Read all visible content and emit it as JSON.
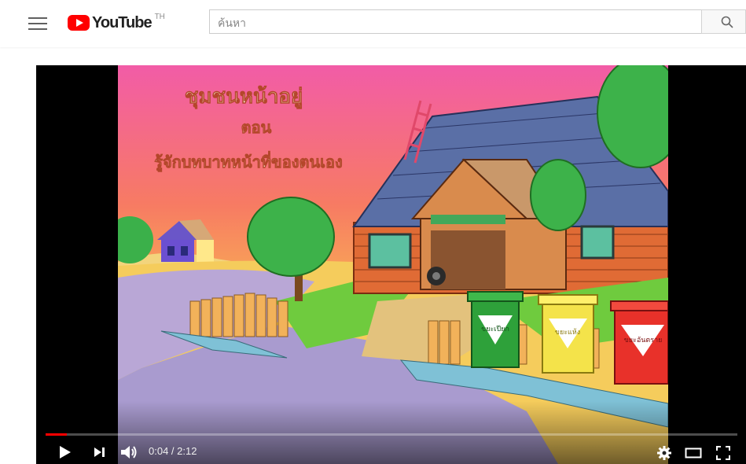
{
  "header": {
    "brand": "YouTube",
    "region": "TH",
    "search": {
      "placeholder": "ค้นหา"
    }
  },
  "player": {
    "overlay_title": {
      "line1": "ชุมชนหน้าอยู่",
      "line2": "ตอน",
      "line3": "รู้จักบทบาทหน้าที่ของตนเอง"
    },
    "time_display": "0:04 / 2:12",
    "progress": 0.031,
    "bin_labels": [
      "ขยะเปียก",
      "ขยะแห้ง",
      "ขยะอันตราย"
    ]
  },
  "colors": {
    "accent": "#ff0000"
  }
}
